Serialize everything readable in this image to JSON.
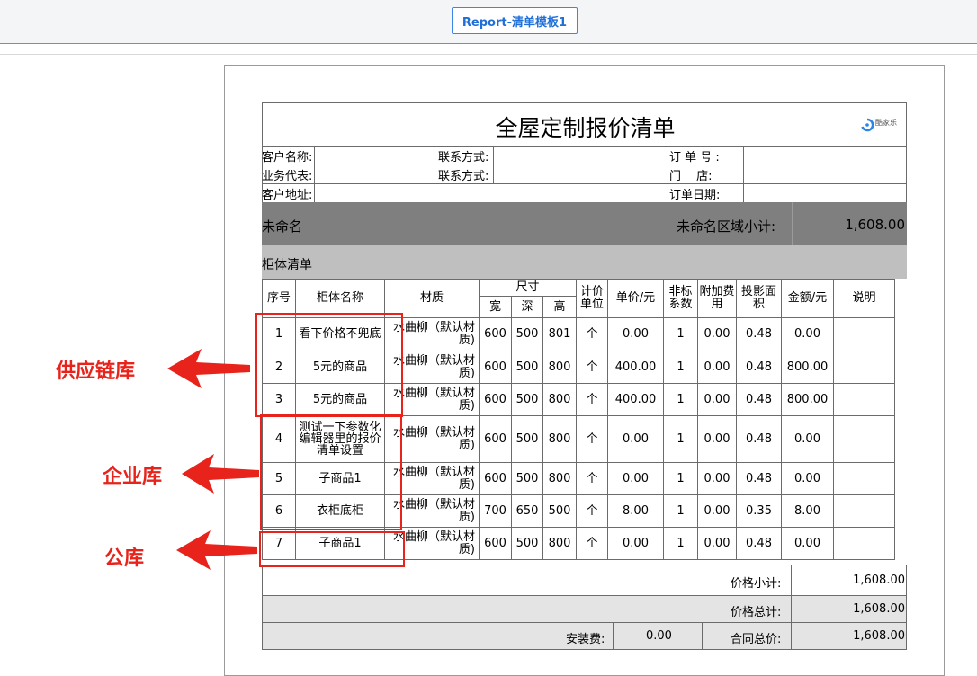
{
  "tab": {
    "label": "Report-清单模板1"
  },
  "report": {
    "title": "全屋定制报价清单",
    "logo_text": "酷家乐",
    "info": {
      "customer_name": "客户名称:",
      "contact1": "联系方式:",
      "order_no": "订 单 号 :",
      "rep": "业务代表:",
      "contact2": "联系方式:",
      "store": "门　 店:",
      "address": "客户地址:",
      "order_date": "订单日期:"
    },
    "section": {
      "name": "未命名",
      "subtotal_label": "未命名区域小计:",
      "subtotal_value": "1,608.00"
    },
    "list_title": "柜体清单",
    "headers": {
      "seq": "序号",
      "name": "柜体名称",
      "material": "材质",
      "size": "尺寸",
      "w": "宽",
      "d": "深",
      "h": "高",
      "unit": "计价单位",
      "price": "单价/元",
      "factor": "非标系数",
      "extra": "附加费用",
      "area": "投影面积",
      "amount": "金额/元",
      "note": "说明"
    },
    "rows": [
      {
        "seq": "1",
        "name": "看下价格不兜底",
        "material": "水曲柳（默认材质)",
        "w": "600",
        "d": "500",
        "h": "801",
        "unit": "个",
        "price": "0.00",
        "factor": "1",
        "extra": "0.00",
        "area": "0.48",
        "amount": "0.00",
        "note": ""
      },
      {
        "seq": "2",
        "name": "5元的商品",
        "material": "水曲柳（默认材质)",
        "w": "600",
        "d": "500",
        "h": "800",
        "unit": "个",
        "price": "400.00",
        "factor": "1",
        "extra": "0.00",
        "area": "0.48",
        "amount": "800.00",
        "note": ""
      },
      {
        "seq": "3",
        "name": "5元的商品",
        "material": "水曲柳（默认材质)",
        "w": "600",
        "d": "500",
        "h": "800",
        "unit": "个",
        "price": "400.00",
        "factor": "1",
        "extra": "0.00",
        "area": "0.48",
        "amount": "800.00",
        "note": ""
      },
      {
        "seq": "4",
        "name": "测试一下参数化编辑器里的报价清单设置",
        "material": "水曲柳（默认材质)",
        "w": "600",
        "d": "500",
        "h": "800",
        "unit": "个",
        "price": "0.00",
        "factor": "1",
        "extra": "0.00",
        "area": "0.48",
        "amount": "0.00",
        "note": ""
      },
      {
        "seq": "5",
        "name": "子商品1",
        "material": "水曲柳（默认材质)",
        "w": "600",
        "d": "500",
        "h": "800",
        "unit": "个",
        "price": "0.00",
        "factor": "1",
        "extra": "0.00",
        "area": "0.48",
        "amount": "0.00",
        "note": ""
      },
      {
        "seq": "6",
        "name": "衣柜底柜",
        "material": "水曲柳（默认材质)",
        "w": "700",
        "d": "650",
        "h": "500",
        "unit": "个",
        "price": "8.00",
        "factor": "1",
        "extra": "0.00",
        "area": "0.35",
        "amount": "8.00",
        "note": ""
      },
      {
        "seq": "7",
        "name": "子商品1",
        "material": "水曲柳（默认材质)",
        "w": "600",
        "d": "500",
        "h": "800",
        "unit": "个",
        "price": "0.00",
        "factor": "1",
        "extra": "0.00",
        "area": "0.48",
        "amount": "0.00",
        "note": ""
      }
    ],
    "summary": {
      "subtotal_label": "价格小计:",
      "subtotal_value": "1,608.00",
      "total_label": "价格总计:",
      "total_value": "1,608.00",
      "install_label": "安装费:",
      "install_value": "0.00",
      "contract_label": "合同总价:",
      "contract_value": "1,608.00"
    }
  },
  "annotations": {
    "supply": "供应链库",
    "enterprise": "企业库",
    "public": "公库",
    "color": "#e8231b"
  }
}
